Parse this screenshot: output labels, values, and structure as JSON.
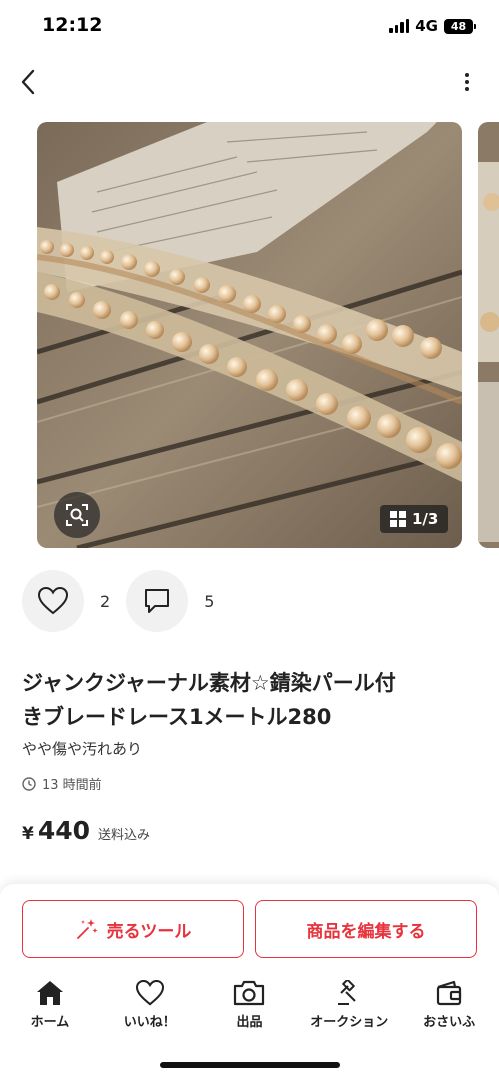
{
  "status": {
    "time": "12:12",
    "network": "4G",
    "battery": "48"
  },
  "carousel": {
    "counter": "1/3"
  },
  "reactions": {
    "likes": "2",
    "comments": "5"
  },
  "item": {
    "title_line1": "ジャンクジャーナル素材☆錆染パール付",
    "title_line2": "きブレードレース1メートル280",
    "condition": "やや傷や汚れあり",
    "posted": "13 時間前",
    "currency": "¥",
    "price": "440",
    "shipping": "送料込み"
  },
  "actions": {
    "sell_tool": "売るツール",
    "edit_item": "商品を編集する"
  },
  "tabs": [
    {
      "label": "ホーム",
      "icon": "home-icon"
    },
    {
      "label": "いいね！",
      "icon": "heart-icon"
    },
    {
      "label": "出品",
      "icon": "camera-icon"
    },
    {
      "label": "オークション",
      "icon": "gavel-icon"
    },
    {
      "label": "おさいふ",
      "icon": "wallet-icon"
    }
  ],
  "colors": {
    "accent": "#e8323c",
    "text": "#222222"
  }
}
